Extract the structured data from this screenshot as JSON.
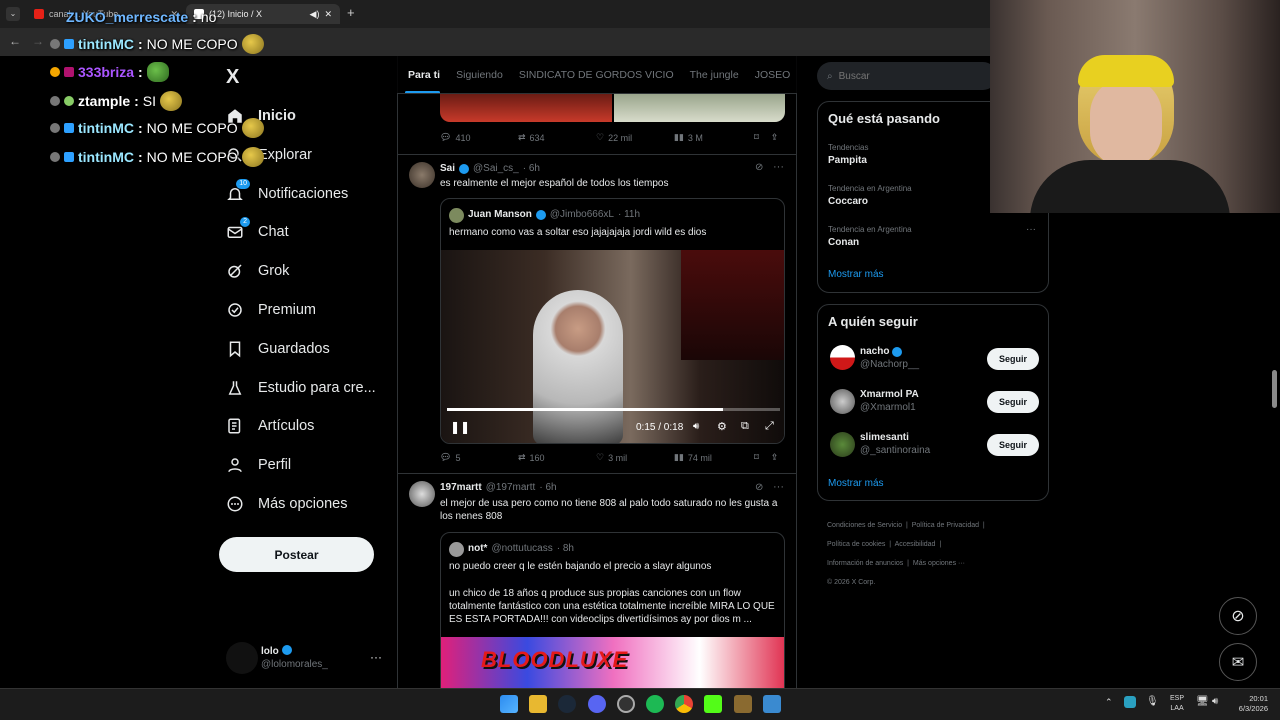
{
  "browser": {
    "tabs": [
      {
        "title": "canal ... YouTube",
        "favicon": "youtube-icon"
      },
      {
        "title": "(12) Inicio / X",
        "favicon": "x-icon"
      }
    ],
    "new_tab": "+"
  },
  "chat_overlay": [
    {
      "user": "ZUKO_merrescate",
      "message": "no",
      "emote": false
    },
    {
      "user": "tintinMC",
      "message": "NO ME COPO",
      "emote": true
    },
    {
      "user": "333briza",
      "message": "",
      "emote": true
    },
    {
      "user": "ztample",
      "message": "SI",
      "emote": true
    },
    {
      "user": "tintinMC",
      "message": "NO ME COPO",
      "emote": true
    },
    {
      "user": "tintinMC",
      "message": "NO ME COPO",
      "emote": true
    }
  ],
  "sidebar": {
    "logo": "X",
    "items": [
      {
        "label": "Inicio",
        "icon": "home-icon"
      },
      {
        "label": "Explorar",
        "icon": "search-icon"
      },
      {
        "label": "Notificaciones",
        "icon": "bell-icon",
        "badge": "10"
      },
      {
        "label": "Chat",
        "icon": "mail-icon",
        "badge": "2"
      },
      {
        "label": "Grok",
        "icon": "grok-icon"
      },
      {
        "label": "Premium",
        "icon": "verified-icon"
      },
      {
        "label": "Guardados",
        "icon": "bookmark-icon"
      },
      {
        "label": "Estudio para cre...",
        "icon": "flask-icon"
      },
      {
        "label": "Artículos",
        "icon": "article-icon"
      },
      {
        "label": "Perfil",
        "icon": "person-icon"
      },
      {
        "label": "Más opciones",
        "icon": "more-circle-icon"
      }
    ],
    "post_button": "Postear",
    "account": {
      "name": "lolo",
      "handle": "@lolomorales_"
    }
  },
  "timeline": {
    "tabs": [
      "Para ti",
      "Siguiendo",
      "SINDICATO DE GORDOS VICIO",
      "The jungle",
      "JOSEO"
    ],
    "post0_actions": {
      "replies": "410",
      "reposts": "634",
      "likes": "22 mil",
      "views": "3 M"
    },
    "post1": {
      "name": "Sai",
      "handle": "@Sai_cs_",
      "time": "6h",
      "text": "es realmente el mejor español de todos los tiempos",
      "quote": {
        "name": "Juan Manson",
        "handle": "@Jimbo666xL",
        "time": "11h",
        "text": "hermano como vas a soltar eso jajajajaja jordi wild es dios",
        "video_time": "0:15 / 0:18",
        "progress": 0.83
      },
      "actions": {
        "replies": "5",
        "reposts": "160",
        "likes": "3 mil",
        "views": "74 mil"
      }
    },
    "post2": {
      "name": "197martt",
      "handle": "@197martt",
      "time": "6h",
      "text": "el mejor de usa pero como no tiene 808 al palo todo saturado no les gusta a los nenes 808",
      "quote": {
        "name": "not*",
        "handle": "@nottutucass",
        "time": "8h",
        "text1": "no puedo creer q le estén bajando el precio a slayr algunos",
        "text2": "un chico de 18 años q produce sus propias canciones con un flow totalmente fantástico con una estética totalmente increíble MIRA LO QUE ES ESTA PORTADA!!! con videoclips divertidísimos ay por dios m ...",
        "image_text": "BLOODLUXE"
      }
    }
  },
  "right": {
    "search_placeholder": "Buscar",
    "trending": {
      "title": "Qué está pasando",
      "items": [
        {
          "context": "Tendencias",
          "name": "Pampita"
        },
        {
          "context": "Tendencia en Argentina",
          "name": "Coccaro"
        },
        {
          "context": "Tendencia en Argentina",
          "name": "Conan"
        }
      ],
      "more": "Mostrar más"
    },
    "who_to_follow": {
      "title": "A quién seguir",
      "users": [
        {
          "name": "nacho",
          "handle": "@Nachorp__",
          "verified": true
        },
        {
          "name": "Xmarmol PA",
          "handle": "@Xmarmol1",
          "verified": false
        },
        {
          "name": "slimesanti",
          "handle": "@_santinoraina",
          "verified": false
        }
      ],
      "follow_label": "Seguir",
      "more": "Mostrar más"
    },
    "footer": [
      "Condiciones de Servicio",
      "Política de Privacidad",
      "Política de cookies",
      "Accesibilidad",
      "Información de anuncios",
      "Más opciones ···",
      "© 2026 X Corp."
    ]
  },
  "taskbar": {
    "lang1": "ESP",
    "lang2": "LAA",
    "time": "20:01",
    "date": "6/3/2026"
  },
  "colors": {
    "accent": "#1d9bf0",
    "bg": "#000000",
    "border": "#2f3336",
    "muted": "#71767b"
  }
}
